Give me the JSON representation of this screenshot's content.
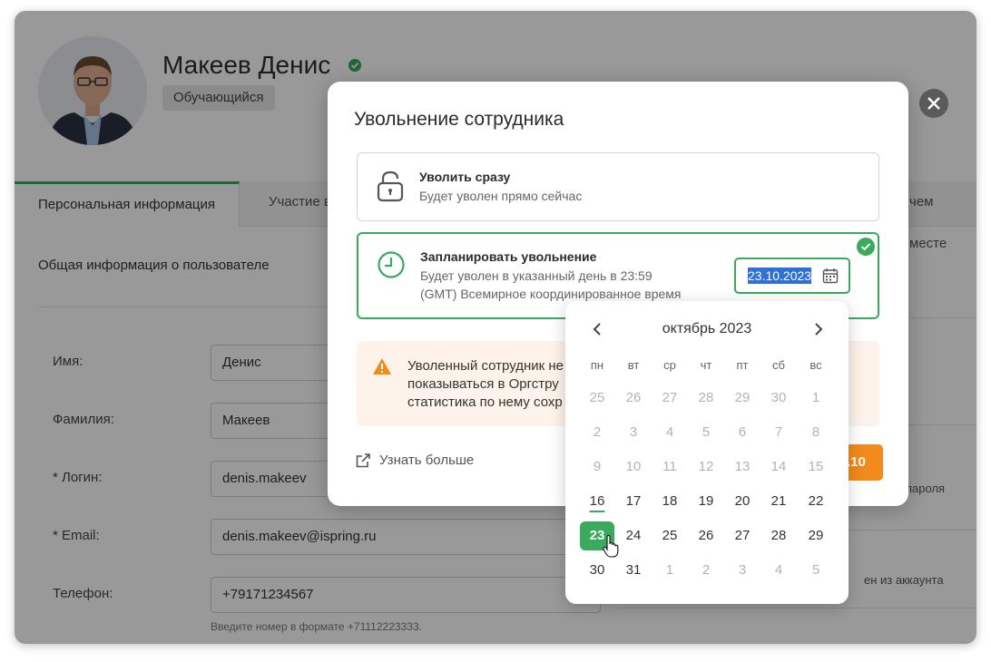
{
  "profile": {
    "name": "Макеев Денис",
    "role": "Обучающийся"
  },
  "tabs": [
    {
      "label": "Персональная информация"
    },
    {
      "label": "Участие в"
    },
    {
      "label": "чем месте"
    }
  ],
  "section_title": "Общая информация о пользователе",
  "form": {
    "first_name_label": "Имя:",
    "first_name_value": "Денис",
    "last_name_label": "Фамилия:",
    "last_name_value": "Макеев",
    "login_label": "*  Логин:",
    "login_value": "denis.makeev",
    "email_label": "*  Email:",
    "email_value": "denis.makeev@ispring.ru",
    "phone_label": "Телефон:",
    "phone_value": "+79171234567",
    "phone_hint": "Введите номер в формате +71112223333."
  },
  "right_col": {
    "text1": "пароля",
    "text2": "ен из аккаунта"
  },
  "modal": {
    "title": "Увольнение сотрудника",
    "option_now": {
      "title": "Уволить сразу",
      "desc": "Будет уволен прямо сейчас"
    },
    "option_scheduled": {
      "title": "Запланировать увольнение",
      "desc_line1": "Будет уволен в указанный день в 23:59",
      "desc_line2": "(GMT) Всемирное координированное время",
      "date_value": "23.10.2023"
    },
    "warning": {
      "line1": "Уволенный сотрудник не",
      "line2": "показываться в Оргстру",
      "line3": "статистика по нему сохр"
    },
    "learn_more": "Узнать больше",
    "confirm_button_partial": ".10"
  },
  "calendar": {
    "month_label": "октябрь 2023",
    "weekdays": [
      "пн",
      "вт",
      "ср",
      "чт",
      "пт",
      "сб",
      "вс"
    ],
    "weeks": [
      [
        "25",
        "26",
        "27",
        "28",
        "29",
        "30",
        "1"
      ],
      [
        "2",
        "3",
        "4",
        "5",
        "6",
        "7",
        "8"
      ],
      [
        "9",
        "10",
        "11",
        "12",
        "13",
        "14",
        "15"
      ],
      [
        "16",
        "17",
        "18",
        "19",
        "20",
        "21",
        "22"
      ],
      [
        "23",
        "24",
        "25",
        "26",
        "27",
        "28",
        "29"
      ],
      [
        "30",
        "31",
        "1",
        "2",
        "3",
        "4",
        "5"
      ]
    ],
    "today": "16",
    "selected": "23"
  },
  "colors": {
    "accent_green": "#3aaa5c",
    "warning_orange": "#f28a1c",
    "selection_blue": "#2e6fd8"
  }
}
